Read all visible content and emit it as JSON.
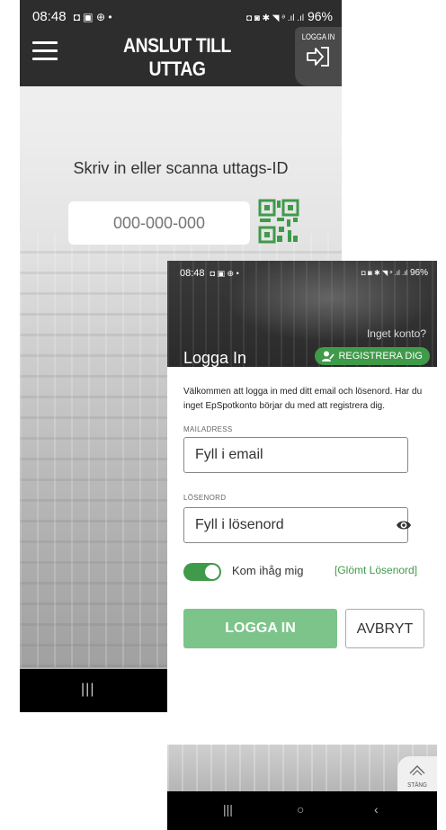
{
  "back_screen": {
    "status_bar": {
      "time": "08:48",
      "left_icons": "◘ ▣ ⊕ •",
      "right_icons": "◘ ◙ ✱ ◥ ᵊ .ıl .ıl",
      "battery": "96%"
    },
    "header": {
      "title": "ANSLUT TILL UTTAG",
      "login_label": "LOGGA IN"
    },
    "scan_label": "Skriv in eller scanna uttags-ID",
    "id_input": {
      "placeholder": "000-000-000"
    },
    "icons": {
      "menu": "hamburger-icon",
      "login": "login-arrow-icon",
      "qr": "qr-code-icon"
    },
    "nav": {
      "recent": "|||"
    }
  },
  "front_screen": {
    "status_bar": {
      "time": "08:48",
      "left_icons": "◘ ▣ ⊕ •",
      "right_icons": "◘ ◙ ✱ ◥ ᵊ .ıl .ıl",
      "battery": "96%"
    },
    "no_account": "Inget konto?",
    "register_label": "REGISTRERA DIG",
    "title": "Logga In",
    "welcome_text": "Välkommen att logga in med ditt email och lösenord. Har du inget EpSpotkonto börjar du med att registrera dig.",
    "email": {
      "label": "MAILADRESS",
      "placeholder": "Fyll i email"
    },
    "password": {
      "label": "LÖSENORD",
      "placeholder": "Fyll i lösenord"
    },
    "remember_label": "Kom ihåg mig",
    "remember_on": true,
    "forgot_label": "[Glömt Lösenord]",
    "login_button": "LOGGA IN",
    "cancel_button": "AVBRYT",
    "close_label": "STÄNG",
    "nav": {
      "recent": "|||",
      "home": "○",
      "back": "‹"
    }
  },
  "colors": {
    "accent_green": "#3f9a4a",
    "login_button": "#7cc48a",
    "appbar": "#2d2d2d"
  }
}
